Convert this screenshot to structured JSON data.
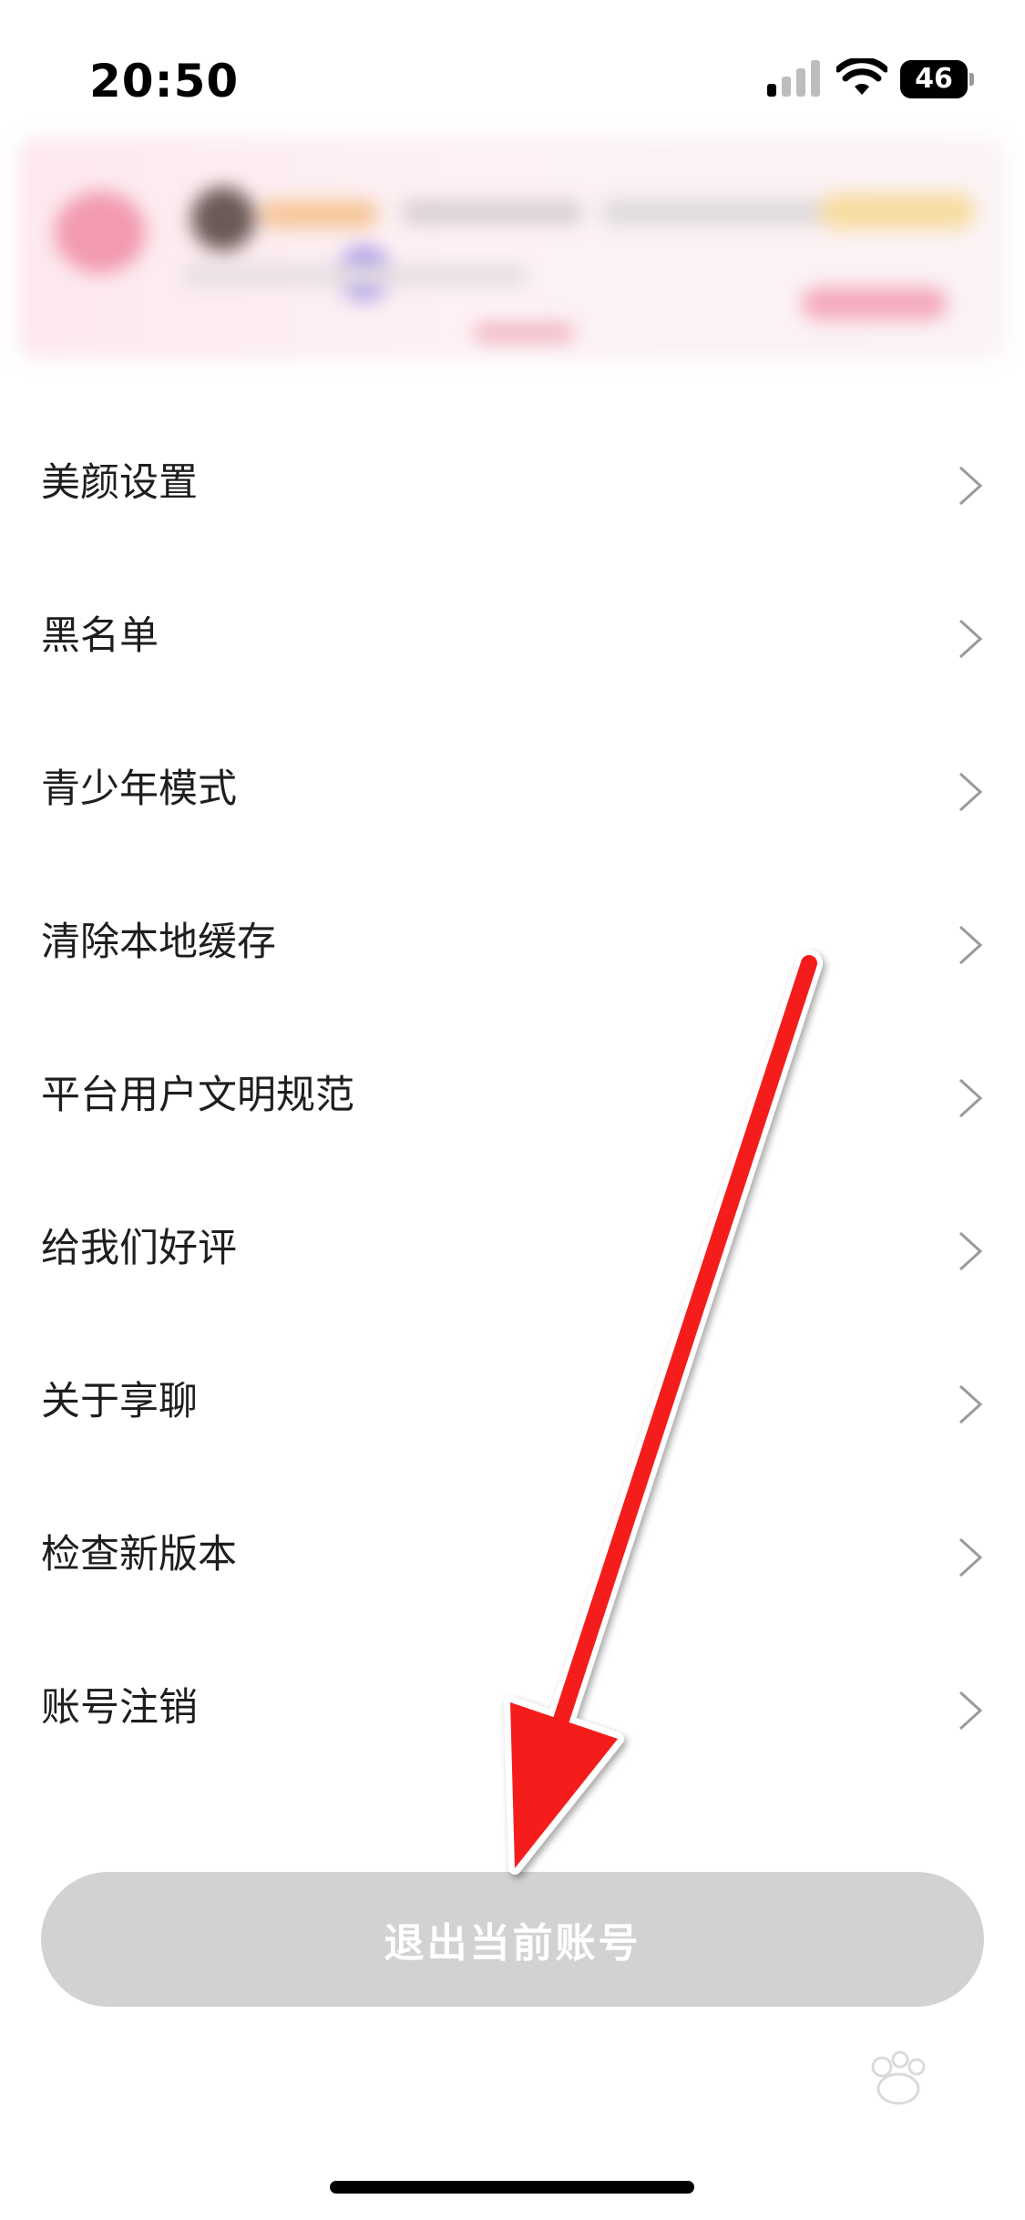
{
  "status_bar": {
    "time": "20:50",
    "battery_level": "46",
    "signal_bars_active": 1,
    "signal_bars_total": 4
  },
  "menu": {
    "items": [
      {
        "label": "美颜设置"
      },
      {
        "label": "黑名单"
      },
      {
        "label": "青少年模式"
      },
      {
        "label": "清除本地缓存"
      },
      {
        "label": "平台用户文明规范"
      },
      {
        "label": "给我们好评"
      },
      {
        "label": "关于享聊"
      },
      {
        "label": "检查新版本"
      },
      {
        "label": "账号注销"
      }
    ]
  },
  "logout": {
    "label": "退出当前账号"
  },
  "colors": {
    "annotation_arrow": "#f51a1a",
    "logout_bg": "#d2d2d2",
    "chevron": "#9a9a9a"
  },
  "icons": {
    "chevron": "chevron-right-icon",
    "wifi": "wifi-icon",
    "signal": "cellular-signal-icon",
    "battery": "battery-icon"
  }
}
